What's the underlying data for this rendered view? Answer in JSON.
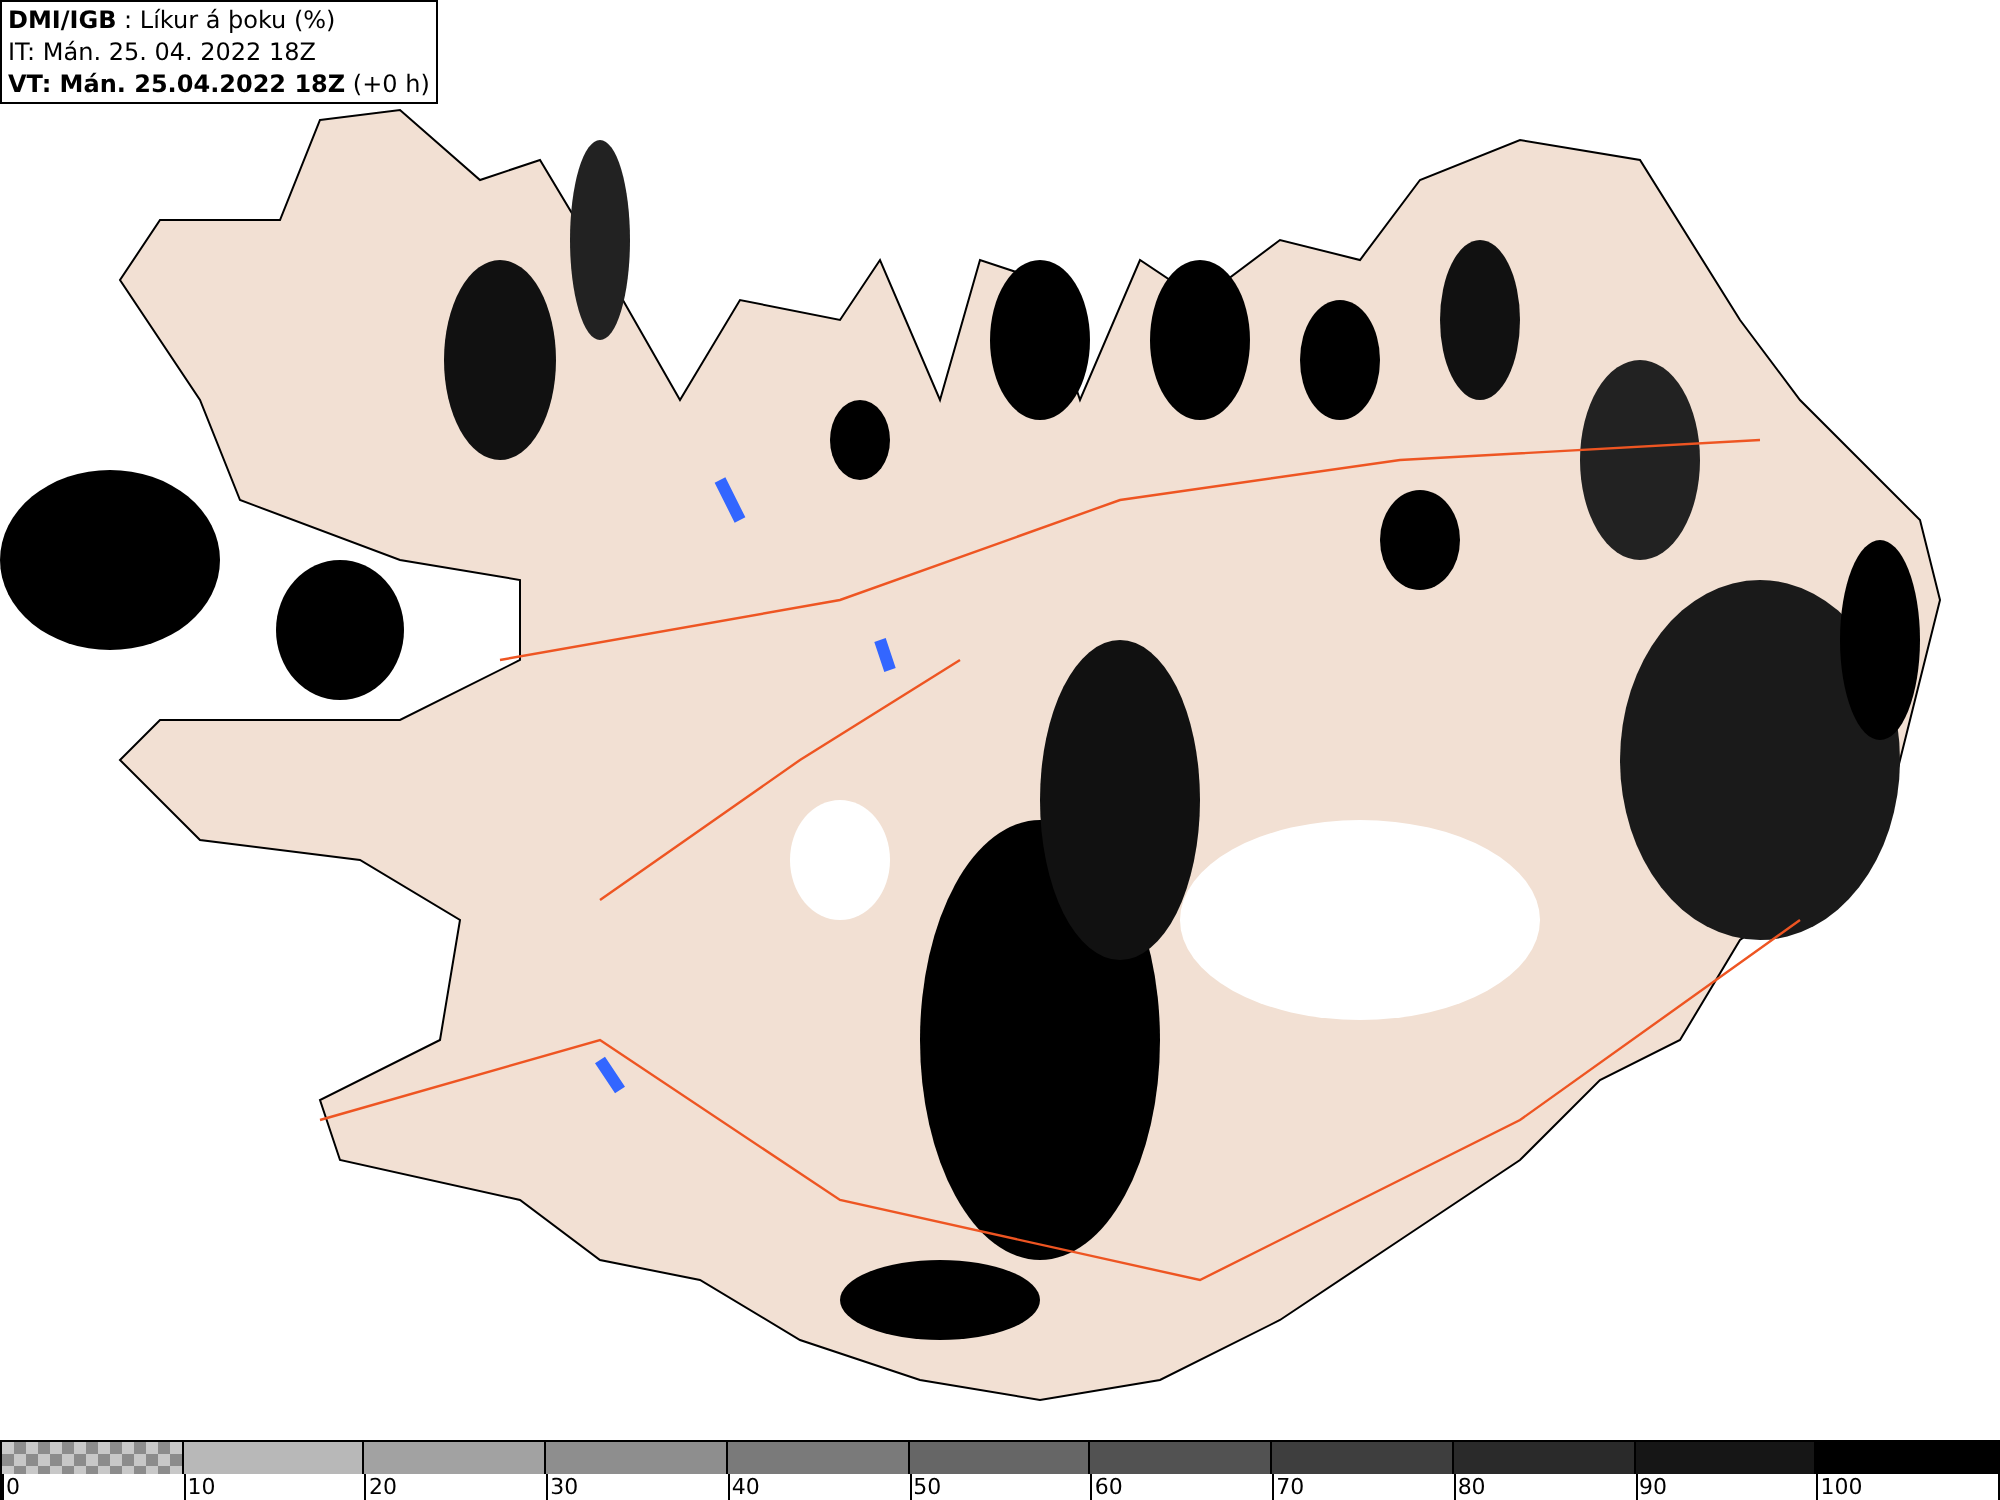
{
  "header": {
    "lines": [
      "**DMI/IGB** : Líkur á þoku (%)",
      "IT: Mán. 25. 04. 2022 18Z",
      "**VT: Mán. 25.04.2022 18Z** (+0 h)"
    ]
  },
  "legend": [
    {
      "label": "0",
      "kind": "checker",
      "color": "#8c8c8c"
    },
    {
      "label": "10",
      "kind": "solid",
      "color": "#b8b8b8"
    },
    {
      "label": "20",
      "kind": "solid",
      "color": "#a2a2a2"
    },
    {
      "label": "30",
      "kind": "solid",
      "color": "#8e8e8e"
    },
    {
      "label": "40",
      "kind": "solid",
      "color": "#7a7a7a"
    },
    {
      "label": "50",
      "kind": "solid",
      "color": "#666666"
    },
    {
      "label": "60",
      "kind": "solid",
      "color": "#525252"
    },
    {
      "label": "70",
      "kind": "solid",
      "color": "#3e3e3e"
    },
    {
      "label": "80",
      "kind": "solid",
      "color": "#2a2a2a"
    },
    {
      "label": "90",
      "kind": "solid",
      "color": "#161616"
    },
    {
      "label": "100",
      "kind": "solid",
      "color": "#000000"
    }
  ]
}
